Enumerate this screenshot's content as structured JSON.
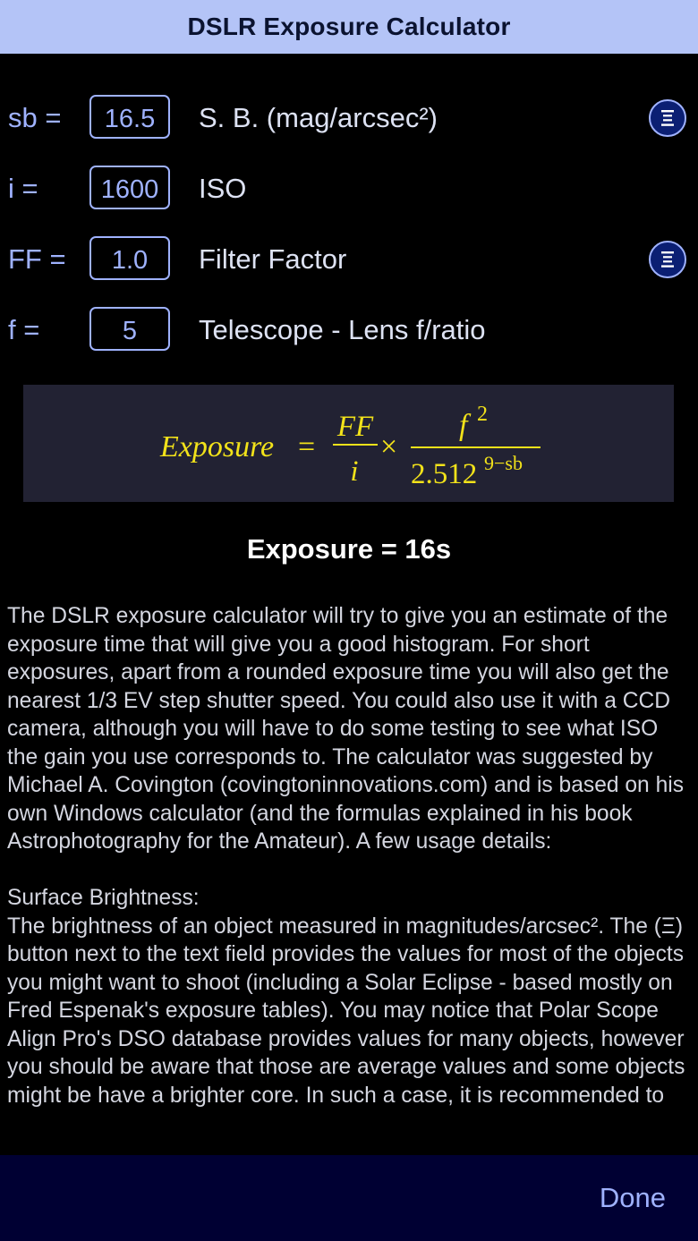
{
  "header": {
    "title": "DSLR Exposure Calculator"
  },
  "rows": [
    {
      "var": "sb =",
      "value": "16.5",
      "label": "S. B. (mag/arcsec²)",
      "has_list_button": true
    },
    {
      "var": "i =",
      "value": "1600",
      "label": "ISO",
      "has_list_button": false
    },
    {
      "var": "FF =",
      "value": "1.0",
      "label": "Filter Factor",
      "has_list_button": true
    },
    {
      "var": "f =",
      "value": "5",
      "label": "Telescope - Lens f/ratio",
      "has_list_button": false
    }
  ],
  "list_button": {
    "icon": "list-icon"
  },
  "formula": {
    "lhs": "Exposure",
    "eq": "=",
    "num1": "FF",
    "den1": "i",
    "times": "×",
    "num2_base": "f",
    "num2_exp": "2",
    "den2_base": "2.512",
    "den2_exp": "9−sb",
    "text_color": "#f2e21a",
    "bg_color": "#222233"
  },
  "result": {
    "text": "Exposure = 16s"
  },
  "description": {
    "paragraph1": "The DSLR exposure calculator will try to give you an estimate of the exposure time that will give you a good histogram. For short exposures, apart from a rounded exposure time you will also get the nearest 1/3 EV step shutter speed. You could also use it with a CCD camera, although you will have to do some testing to see what ISO the gain you use corresponds to. The calculator was suggested by Michael A. Covington (covingtoninnovations.com) and is based on his own Windows calculator (and the formulas explained in his book Astrophotography for the Amateur). A few usage details:",
    "heading2": "Surface Brightness:",
    "paragraph2": "The brightness of an object measured in magnitudes/arcsec². The (Ξ) button next to the text field provides the values for most of the objects you might want to shoot (including a Solar Eclipse - based mostly on Fred Espenak's exposure tables). You may notice that Polar Scope Align Pro's DSO database provides values for many objects, however you should be aware that those are average values and some objects might be have a brighter core. In such a case, it is recommended to"
  },
  "footer": {
    "done_label": "Done"
  },
  "colors": {
    "header_bg": "#b4c4f7",
    "accent": "#9fb2ff",
    "footer_bg": "#000033"
  }
}
